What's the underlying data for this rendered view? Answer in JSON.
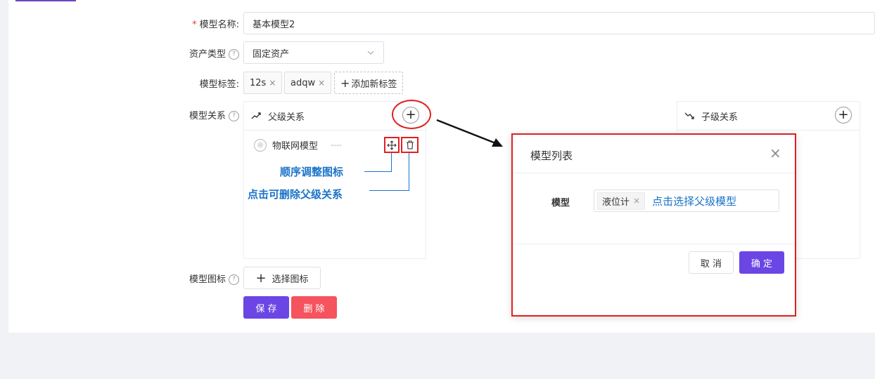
{
  "form": {
    "model_name_label": "模型名称:",
    "model_name_value": "基本模型2",
    "asset_type_label": "资产类型",
    "asset_type_value": "固定资产",
    "model_tags_label": "模型标签:",
    "tags": [
      "12s",
      "adqw"
    ],
    "add_tag_label": "添加新标签",
    "relation_label": "模型关系",
    "icon_label": "模型图标",
    "choose_icon_label": "选择图标",
    "save_label": "保 存",
    "delete_label": "删 除"
  },
  "parent_card": {
    "title": "父级关系",
    "item_name": "物联网模型",
    "item_dash": "----"
  },
  "child_card": {
    "title": "子级关系"
  },
  "annotations": {
    "order_icon": "顺序调整图标",
    "delete_relation": "点击可删除父级关系",
    "select_parent": "点击选择父级模型"
  },
  "modal": {
    "title": "模型列表",
    "model_label": "模型",
    "selected_tag": "液位计",
    "cancel_label": "取 消",
    "confirm_label": "确 定"
  },
  "colors": {
    "accent": "#6b46e5",
    "danger": "#f5535e",
    "annotation": "#1a73c8",
    "highlight": "#e02020"
  }
}
